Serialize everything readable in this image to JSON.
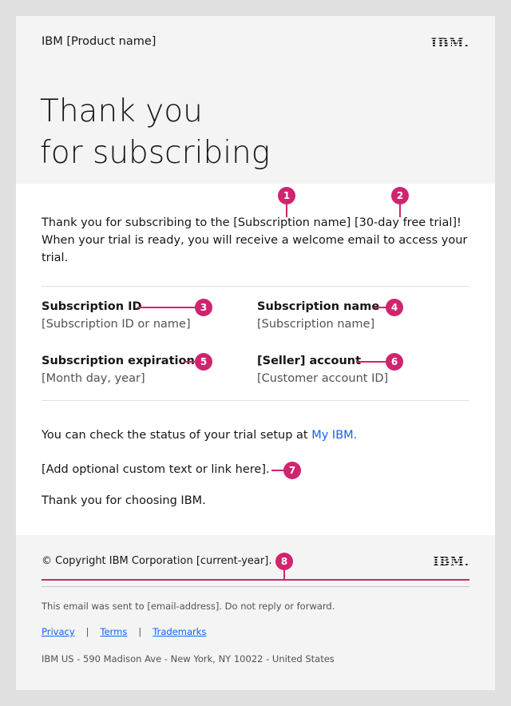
{
  "header": {
    "product": "IBM [Product name]",
    "logo": "IBM.",
    "headline_line1": "Thank you",
    "headline_line2": "for subscribing"
  },
  "intro": "Thank you for subscribing to the [Subscription name] [30-day free trial]! When your trial is ready, you will receive a welcome email to access your trial.",
  "fields": [
    {
      "label": "Subscription ID",
      "value": "[Subscription ID or name]"
    },
    {
      "label": "Subscription name",
      "value": "[Subscription name]"
    },
    {
      "label": "Subscription expiration",
      "value": "[Month day, year]"
    },
    {
      "label": "[Seller] account",
      "value": "[Customer account ID]"
    }
  ],
  "status": {
    "text": "You can check the status of your trial setup at ",
    "link": "My IBM."
  },
  "custom_text": "[Add optional custom text or link here].",
  "thanks": "Thank you for choosing IBM.",
  "footer": {
    "copyright": "© Copyright IBM Corporation [current-year].",
    "logo": "IBM.",
    "notice": "This email was sent to [email-address]. Do not reply or forward.",
    "links": [
      "Privacy",
      "Terms",
      "Trademarks"
    ],
    "separator": "|",
    "address": "IBM US - 590 Madison Ave - New York, NY 10022 - United States"
  },
  "annotations": [
    "1",
    "2",
    "3",
    "4",
    "5",
    "6",
    "7",
    "8"
  ],
  "colors": {
    "accent": "#d0246f",
    "link": "#0f62fe",
    "background": "#e0e0e0",
    "panel": "#f4f4f4"
  }
}
